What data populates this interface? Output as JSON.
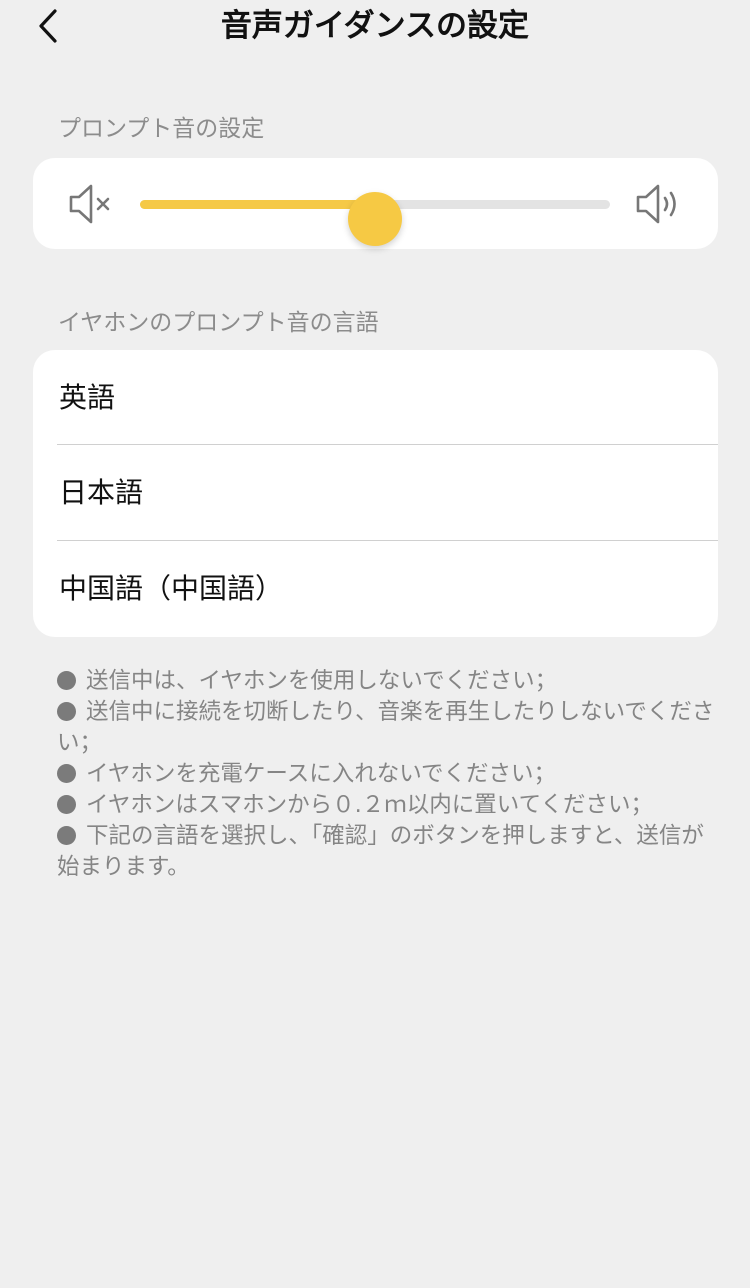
{
  "header": {
    "title": "音声ガイダンスの設定",
    "back_icon": "chevron-left-icon"
  },
  "prompt_volume": {
    "label": "プロンプト音の設定",
    "mute_icon": "speaker-mute-icon",
    "loud_icon": "speaker-loud-icon",
    "level": 0.5,
    "accent_color": "#f6c944"
  },
  "language": {
    "label": "イヤホンのプロンプト音の言語",
    "options": [
      "英語",
      "日本語",
      "中国語（中国語）"
    ]
  },
  "notes": [
    "送信中は、イヤホンを使用しないでください；",
    "送信中に接続を切断したり、音楽を再生したりしないでください；",
    "イヤホンを充電ケースに入れないでください；",
    "イヤホンはスマホンから０.２ｍ以内に置いてください；",
    "下記の言語を選択し、「確認」のボタンを押しますと、送信が始まります。"
  ]
}
